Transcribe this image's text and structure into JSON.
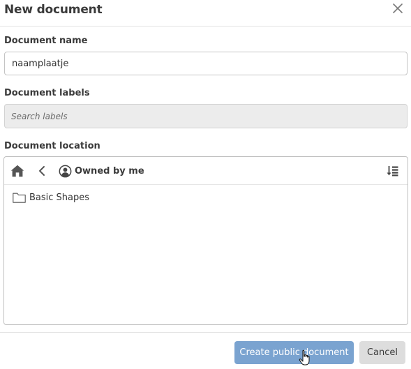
{
  "dialog": {
    "title": "New document",
    "close_icon": "close-icon"
  },
  "fields": {
    "name_label": "Document name",
    "name_value": "naamplaatje",
    "labels_label": "Document labels",
    "labels_placeholder": "Search labels",
    "location_label": "Document location"
  },
  "location": {
    "home_icon": "home-icon",
    "back_icon": "chevron-left-icon",
    "owner_icon": "user-circle-icon",
    "owner_label": "Owned by me",
    "sort_icon": "sort-icon",
    "items": [
      {
        "type": "folder",
        "icon": "folder-icon",
        "label": "Basic Shapes"
      }
    ]
  },
  "footer": {
    "create_label": "Create public document",
    "cancel_label": "Cancel"
  },
  "colors": {
    "primary_button": "#7aa3d0",
    "cancel_button": "#dddddd",
    "labels_field_bg": "#ececec"
  }
}
